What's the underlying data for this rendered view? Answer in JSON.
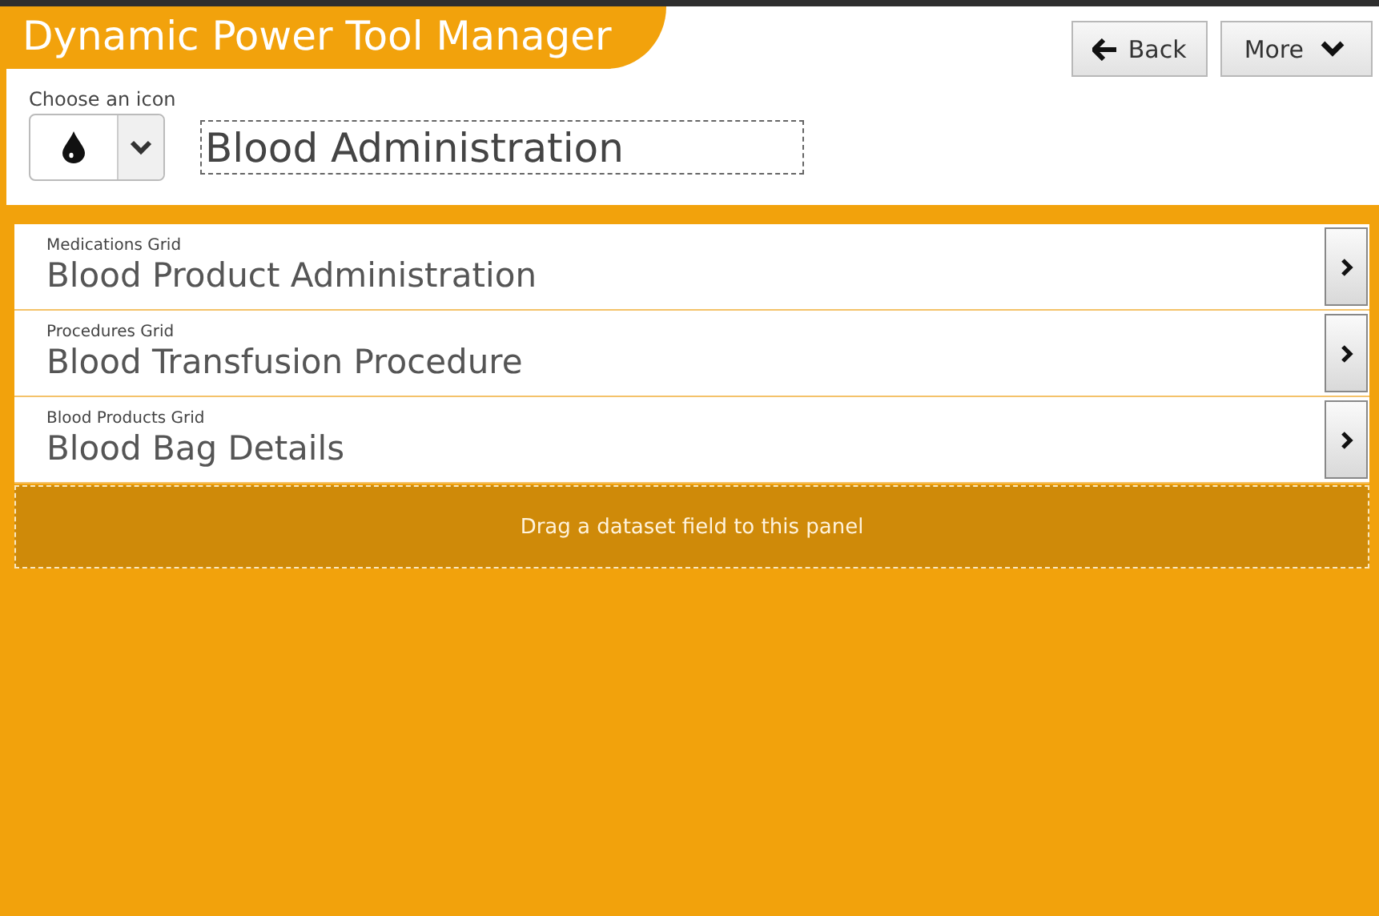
{
  "header": {
    "title": "Dynamic Power Tool Manager",
    "buttons": [
      {
        "kind": "back",
        "label": "Back"
      },
      {
        "kind": "more",
        "label": "More"
      }
    ]
  },
  "icon_picker": {
    "label": "Choose an icon"
  },
  "name_field": {
    "value": "Blood Administration"
  },
  "grids": [
    {
      "type": "Medications Grid",
      "title": "Blood Product Administration"
    },
    {
      "type": "Procedures Grid",
      "title": "Blood Transfusion Procedure"
    },
    {
      "type": "Blood Products Grid",
      "title": "Blood Bag Details"
    }
  ],
  "drop_panel": {
    "text": "Drag a dataset field to this panel"
  }
}
